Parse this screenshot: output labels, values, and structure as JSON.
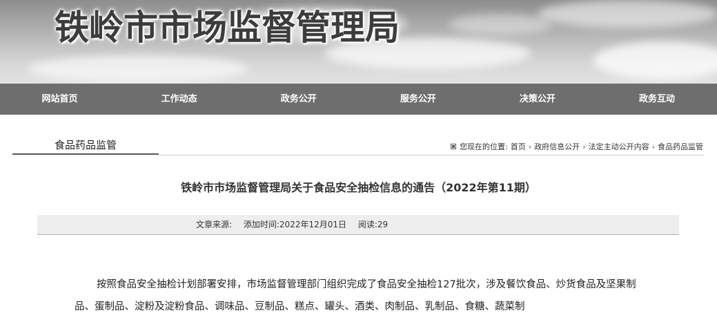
{
  "header": {
    "site_title": "铁岭市市场监督管理局"
  },
  "nav": {
    "items": [
      {
        "label": "网站首页"
      },
      {
        "label": "工作动态"
      },
      {
        "label": "政务公开"
      },
      {
        "label": "服务公开"
      },
      {
        "label": "决策公开"
      },
      {
        "label": "政务互动"
      }
    ]
  },
  "section": {
    "tab_label": "食品药品监管"
  },
  "breadcrumb": {
    "label": "您现在的位置:",
    "items": [
      "首页",
      "政府信息公开",
      "法定主动公开内容",
      "食品药品监管"
    ],
    "separator": "›"
  },
  "article": {
    "title": "铁岭市市场监督管理局关于食品安全抽检信息的通告（2022年第11期）",
    "meta": {
      "source": "文章来源:",
      "date": "添加时间:2022年12月01日",
      "reads": "阅读:29"
    },
    "body": "按照食品安全抽检计划部署安排，市场监督管理部门组织完成了食品安全抽检127批次，涉及餐饮食品、炒货食品及坚果制品、蛋制品、淀粉及淀粉食品、调味品、豆制品、糕点、罐头、酒类、肉制品、乳制品、食糖、蔬菜制"
  }
}
